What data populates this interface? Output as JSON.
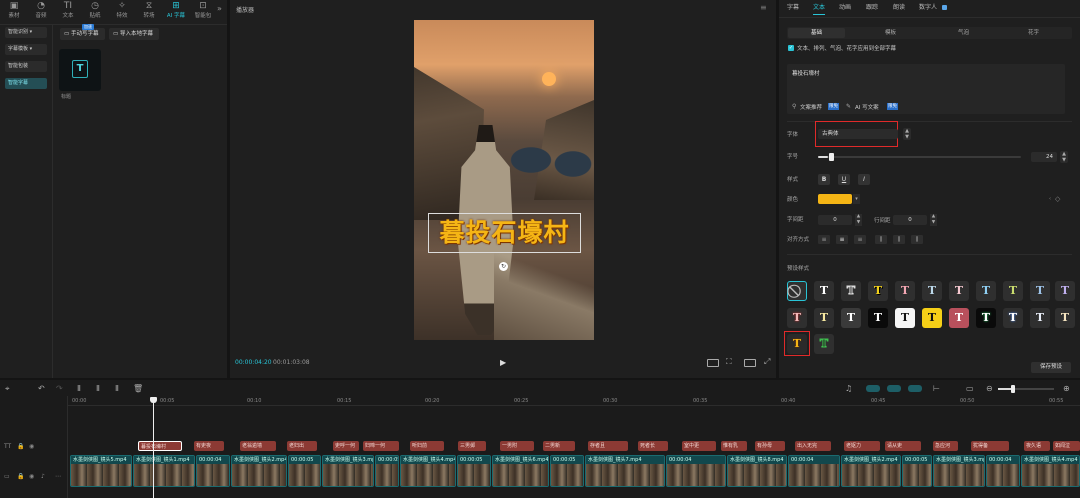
{
  "toolbar": {
    "tabs": [
      {
        "label": "素材",
        "icon": "media-icon"
      },
      {
        "label": "音频",
        "icon": "audio-icon"
      },
      {
        "label": "文本",
        "icon": "text-icon"
      },
      {
        "label": "贴纸",
        "icon": "sticker-icon"
      },
      {
        "label": "特效",
        "icon": "effects-icon"
      },
      {
        "label": "转场",
        "icon": "transition-icon"
      },
      {
        "label": "AI 字幕",
        "icon": "ai-caption-icon"
      },
      {
        "label": "智能包",
        "icon": "smart-pack-icon"
      }
    ]
  },
  "left_menu": {
    "items": [
      "智能识别 ▾",
      "字幕模板 ▾",
      "智能包装",
      "智能字幕"
    ]
  },
  "caption_panel": {
    "manual_badge": "加速",
    "manual_button": "手动写字幕",
    "import_button": "导入本地字幕",
    "template_label": "标题"
  },
  "player": {
    "title": "播放器",
    "overlay_text": "暮投石壕村",
    "time_current": "00:00:04:20",
    "time_total": "00:01:03:08"
  },
  "right_panel": {
    "tabs": [
      "字幕",
      "文本",
      "动画",
      "跟踪",
      "朗读",
      "数字人"
    ],
    "subtabs": [
      "基础",
      "模板",
      "气泡",
      "花字"
    ],
    "apply_all": "文本、排列、气泡、花字应用到全部字幕",
    "text_value": "暮投石壕村",
    "ai_recommend": "文案推荐",
    "ai_recommend_badge": "限免",
    "ai_write": "AI 写文案",
    "ai_write_badge": "限免",
    "font_label": "字体",
    "font_value": "古典体",
    "size_label": "字号",
    "size_value": "24",
    "size_fraction": 0.05,
    "style_label": "样式",
    "style_buttons": [
      "B",
      "U",
      "I"
    ],
    "color_label": "颜色",
    "color_value": "#f5b515",
    "spacing_label": "字间距",
    "spacing_value": "0",
    "lineheight_label": "行间距",
    "lineheight_value": "0",
    "align_label": "对齐方式",
    "preset_label": "预设样式",
    "save_button": "保存预设"
  },
  "timeline": {
    "ruler": [
      "00:00",
      "00:05",
      "00:10",
      "00:15",
      "00:20",
      "00:25",
      "00:30",
      "00:35",
      "00:40",
      "00:45",
      "00:50",
      "00:55"
    ],
    "text_clips": [
      "暮投石壕村",
      "有吏夜",
      "老翁逾墙",
      "老妇出",
      "吏呼一何",
      "妇啼一何",
      "听妇前",
      "三男邺",
      "一男附",
      "二男新",
      "存者且",
      "死者长",
      "室中更",
      "惟有乳",
      "有孙母",
      "出入无完",
      "老妪力",
      "请从吏",
      "急应河",
      "犹得备",
      "夜久语",
      "如闻泣"
    ],
    "video_clips": [
      "水墨剑侠图_镜头5.mp4",
      "水墨剑侠图_镜头1.mp4",
      "00:00:04",
      "水墨剑侠图_镜头2.mp4",
      "00:00:05",
      "水墨剑侠图_镜头3.mp4",
      "00:00:05",
      "水墨剑侠图_镜头4.mp4",
      "00:00:05",
      "水墨剑侠图_镜头6.mp4",
      "00:00:05",
      "水墨剑侠图_镜头7.mp4",
      "00:00:04",
      "水墨剑侠图_镜头8.mp4",
      "00:00:04",
      "水墨剑侠图_镜头2.mp4",
      "00:00:05",
      "水墨剑侠图_镜头3.mp4",
      "00:00:04",
      "水墨剑侠图_镜头4.mp4"
    ]
  },
  "colors": {
    "accent": "#29c4d6",
    "highlight_red": "#e02a2a",
    "text_color_swatch": "#f5b515"
  }
}
